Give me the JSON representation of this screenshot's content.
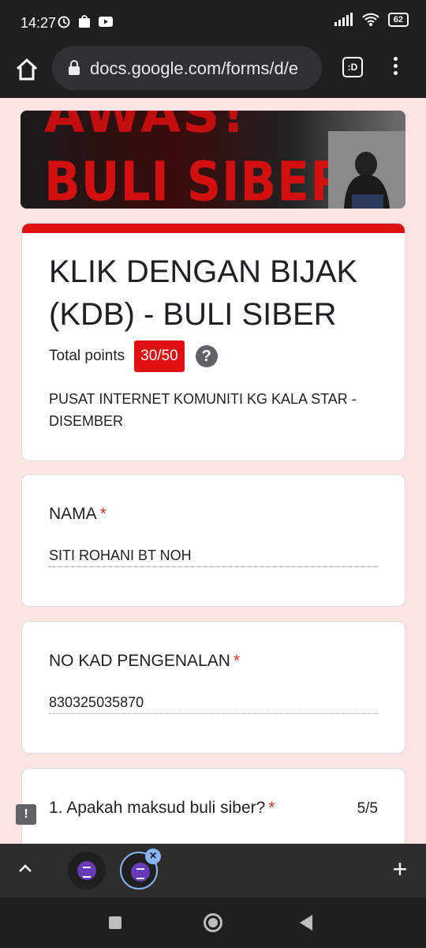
{
  "status_bar": {
    "time": "14:27",
    "battery": "62"
  },
  "browser": {
    "url": "docs.google.com/forms/d/e",
    "tab_count": ":D"
  },
  "banner": {
    "line1": "AWAS!",
    "line2": "BULI SIBER"
  },
  "form": {
    "title": "KLIK DENGAN BIJAK (KDB) - BULI SIBER",
    "total_points_label": "Total points",
    "score": "30/50",
    "help": "?",
    "description": "PUSAT INTERNET KOMUNITI KG KALA STAR - DISEMBER"
  },
  "questions": [
    {
      "label": "NAMA",
      "required": "*",
      "answer": "SITI ROHANI BT NOH"
    },
    {
      "label": "NO KAD PENGENALAN",
      "required": "*",
      "answer": "830325035870"
    },
    {
      "label": "1. Apakah maksud buli siber?",
      "required": "*",
      "score": "5/5"
    }
  ],
  "colors": {
    "accent": "#e01010",
    "page_bg": "#fce4e4"
  },
  "icons": [
    "home-icon",
    "lock-icon",
    "menu-icon",
    "help-icon",
    "feedback-icon",
    "chevron-up-icon",
    "close-icon",
    "plus-icon"
  ]
}
